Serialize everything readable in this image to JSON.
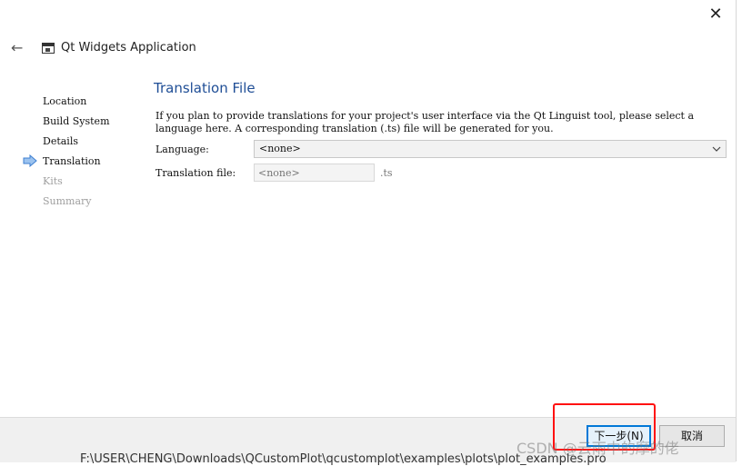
{
  "window": {
    "title": "Qt Widgets Application",
    "close_glyph": "✕",
    "back_glyph": "←"
  },
  "steps": [
    {
      "label": "Location",
      "state": "done"
    },
    {
      "label": "Build System",
      "state": "done"
    },
    {
      "label": "Details",
      "state": "done"
    },
    {
      "label": "Translation",
      "state": "current"
    },
    {
      "label": "Kits",
      "state": "disabled"
    },
    {
      "label": "Summary",
      "state": "disabled"
    }
  ],
  "page": {
    "title": "Translation File",
    "intro": "If you plan to provide translations for your project's user interface via the Qt Linguist tool, please select a language here. A corresponding translation (.ts) file will be generated for you.",
    "language_label": "Language:",
    "language_value": "<none>",
    "translation_file_label": "Translation file:",
    "translation_file_placeholder": "<none>",
    "translation_file_suffix": ".ts"
  },
  "footer": {
    "next_label": "下一步(N)",
    "cancel_label": "取消"
  },
  "overlay": {
    "watermark": "CSDN @云雨中的摩的佬",
    "background_path": "F:\\USER\\CHENG\\Downloads\\QCustomPlot\\qcustomplot\\examples\\plots\\plot_examples.pro"
  },
  "colors": {
    "accent": "#1f4e96",
    "highlight_box": "#ff1111",
    "focus_border": "#0078d7"
  }
}
